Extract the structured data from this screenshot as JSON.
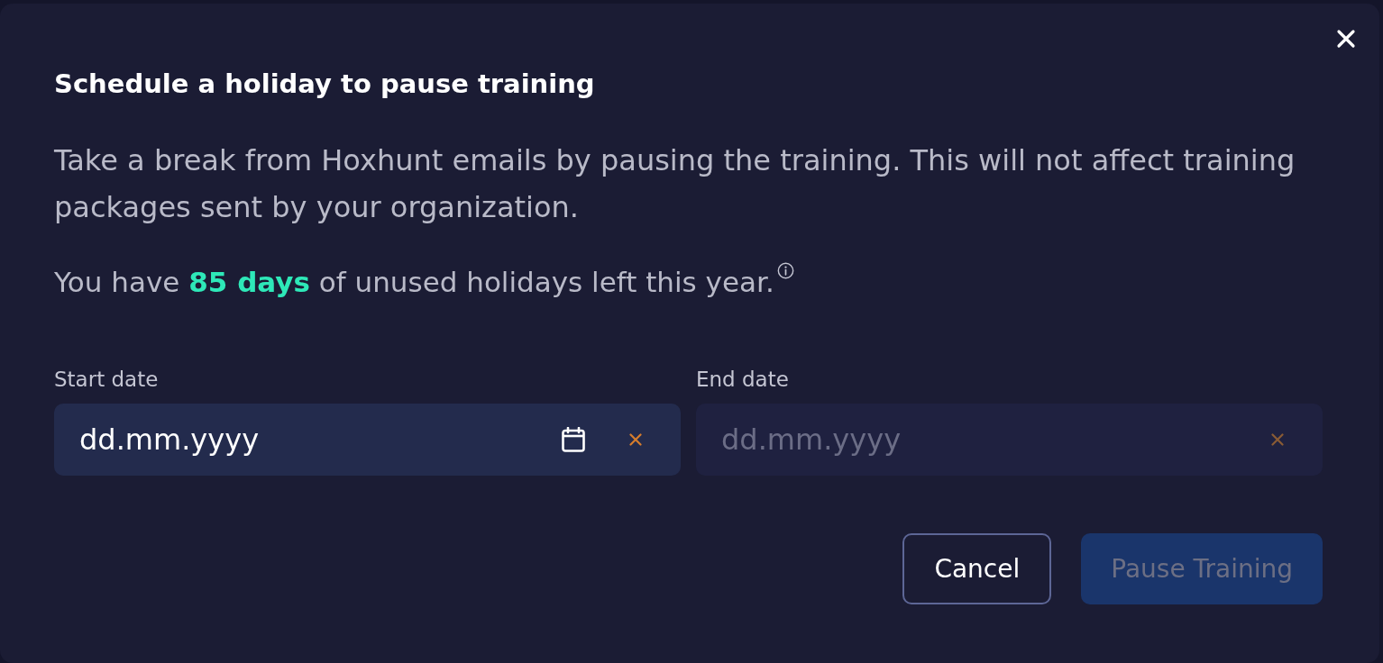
{
  "dialog": {
    "title": "Schedule a holiday to pause training",
    "description": "Take a break from Hoxhunt emails by pausing the training. This will not affect training packages sent by your organization.",
    "allowance": "You have **85 days** of unused holidays left this year.",
    "fields": [
      {
        "label": "Start date",
        "placeholder": "dd.mm.yyyy",
        "disabled": false
      },
      {
        "label": "End date",
        "placeholder": "dd.mm.yyyy",
        "disabled": true
      }
    ],
    "buttons": [
      {
        "label": "Cancel",
        "kind": "secondary",
        "disabled": false
      },
      {
        "label": "Pause Training",
        "kind": "primary",
        "disabled": true
      }
    ]
  }
}
